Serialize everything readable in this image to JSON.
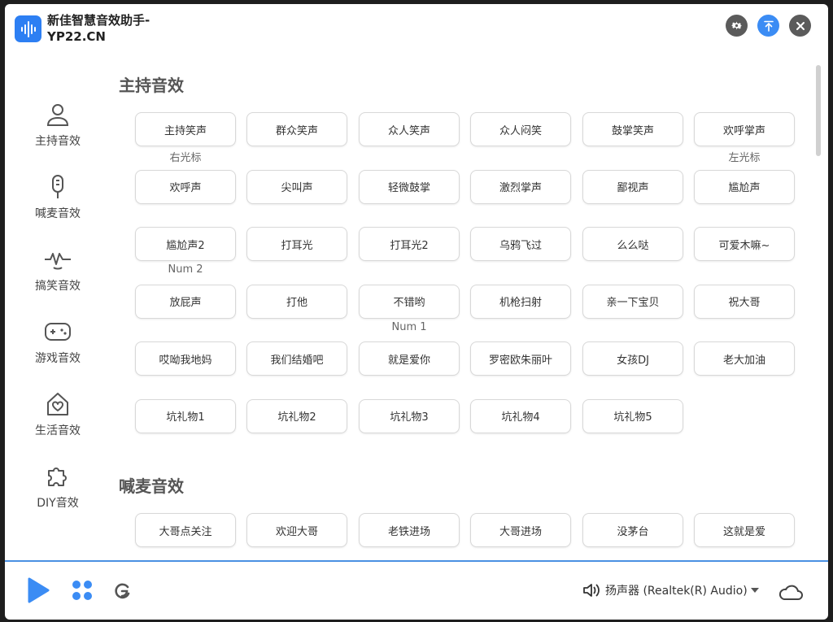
{
  "app": {
    "title": "新佳智慧音效助手-YP22.CN",
    "colors": {
      "accent": "#2d7ff3",
      "text": "#333333"
    }
  },
  "sidebar": {
    "items": [
      {
        "label": "主持音效",
        "icon": "person-icon"
      },
      {
        "label": "喊麦音效",
        "icon": "microphone-icon"
      },
      {
        "label": "搞笑音效",
        "icon": "funny-face-icon"
      },
      {
        "label": "游戏音效",
        "icon": "gamepad-icon"
      },
      {
        "label": "生活音效",
        "icon": "home-heart-icon"
      },
      {
        "label": "DIY音效",
        "icon": "puzzle-icon"
      }
    ]
  },
  "sections": {
    "host": {
      "title": "主持音效",
      "buttons": [
        "主持笑声",
        "群众笑声",
        "众人笑声",
        "众人闷笑",
        "鼓掌笑声",
        "欢呼掌声",
        "欢呼声",
        "尖叫声",
        "轻微鼓掌",
        "激烈掌声",
        "鄙视声",
        "尴尬声",
        "尴尬声2",
        "打耳光",
        "打耳光2",
        "乌鸦飞过",
        "么么哒",
        "可爱木嘛~",
        "放屁声",
        "打他",
        "不错哟",
        "机枪扫射",
        "亲一下宝贝",
        "祝大哥",
        "哎呦我地妈",
        "我们结婚吧",
        "就是爱你",
        "罗密欧朱丽叶",
        "女孩DJ",
        "老大加油",
        "坑礼物1",
        "坑礼物2",
        "坑礼物3",
        "坑礼物4",
        "坑礼物5"
      ],
      "hotkeys": {
        "right_cursor": "右光标",
        "left_cursor": "左光标",
        "num2": "Num 2",
        "num1": "Num 1"
      }
    },
    "shout": {
      "title": "喊麦音效",
      "buttons": [
        "大哥点关注",
        "欢迎大哥",
        "老铁进场",
        "大哥进场",
        "没茅台",
        "这就是爱"
      ]
    }
  },
  "footer": {
    "audio_device": "扬声器 (Realtek(R) Audio)"
  }
}
